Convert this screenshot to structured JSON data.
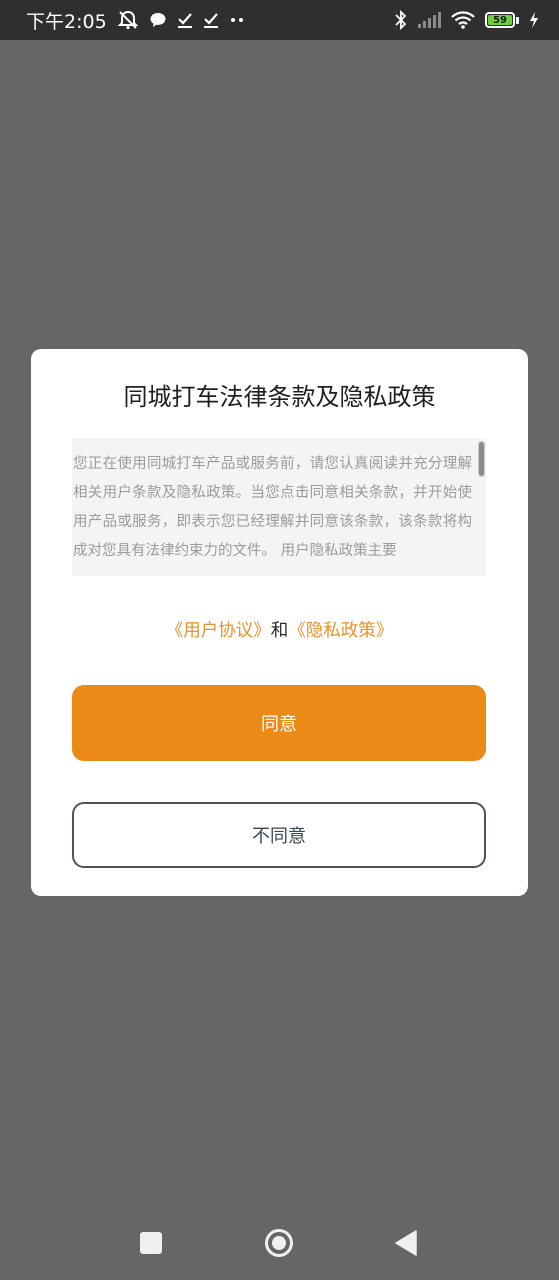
{
  "status_bar": {
    "time": "下午2:05",
    "battery_level": "59",
    "icons": [
      "mute-bell-icon",
      "chat-bubble-icon",
      "check-icon",
      "check-icon",
      "more-dots-icon",
      "bluetooth-icon",
      "signal-icon",
      "wifi-icon",
      "battery-icon",
      "charging-bolt-icon"
    ],
    "battery_color": "#6fd13b"
  },
  "dialog": {
    "title": "同城打车法律条款及隐私政策",
    "terms_text": "您正在使用同城打车产品或服务前，请您认真阅读并充分理解相关用户条款及隐私政策。当您点击同意相关条款，并开始使用产品或服务，即表示您已经理解并同意该条款，该条款将构成对您具有法律约束力的文件。 用户隐私政策主要",
    "user_agreement_link": "《用户协议》",
    "joiner": "和",
    "privacy_policy_link": "《隐私政策》",
    "agree_label": "同意",
    "disagree_label": "不同意",
    "accent_color": "#ec8a17",
    "link_color": "#e8922a"
  },
  "nav_bar": {
    "icons": [
      "recent-apps-square-icon",
      "home-circle-icon",
      "back-triangle-icon"
    ]
  }
}
